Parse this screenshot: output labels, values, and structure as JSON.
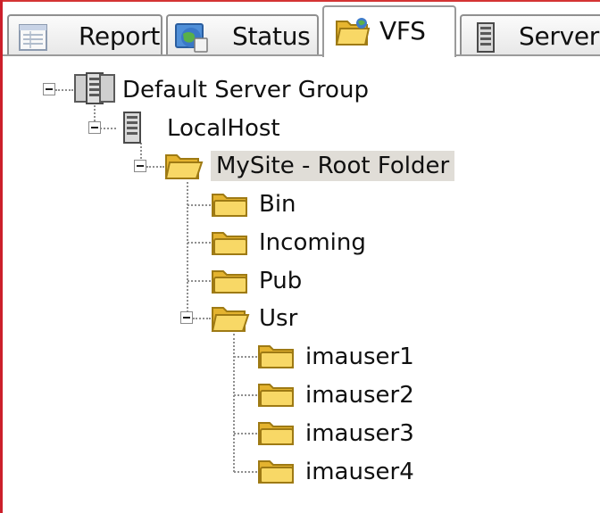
{
  "tabs": [
    {
      "label": "Report",
      "icon": "report-icon",
      "active": false
    },
    {
      "label": "Status",
      "icon": "globe-icon",
      "active": false
    },
    {
      "label": "VFS",
      "icon": "folder-open-icon",
      "active": true
    },
    {
      "label": "Server",
      "icon": "server-icon",
      "active": false
    }
  ],
  "tree": {
    "server_group": {
      "label": "Default Server Group",
      "icon": "server-group-icon"
    },
    "server": {
      "label": "LocalHost",
      "icon": "server-icon"
    },
    "root_folder": {
      "label": "MySite - Root Folder",
      "icon": "folder-open-icon",
      "selected": true
    },
    "folders": [
      {
        "label": "Bin"
      },
      {
        "label": "Incoming"
      },
      {
        "label": "Pub"
      },
      {
        "label": "Usr",
        "expanded": true
      }
    ],
    "usr_children": [
      {
        "label": "imauser1"
      },
      {
        "label": "imauser2"
      },
      {
        "label": "imauser3"
      },
      {
        "label": "imauser4"
      }
    ]
  },
  "colors": {
    "frame_red": "#cc1f2a",
    "selection": "#e0ddd7",
    "folder": "#f6cd47"
  }
}
